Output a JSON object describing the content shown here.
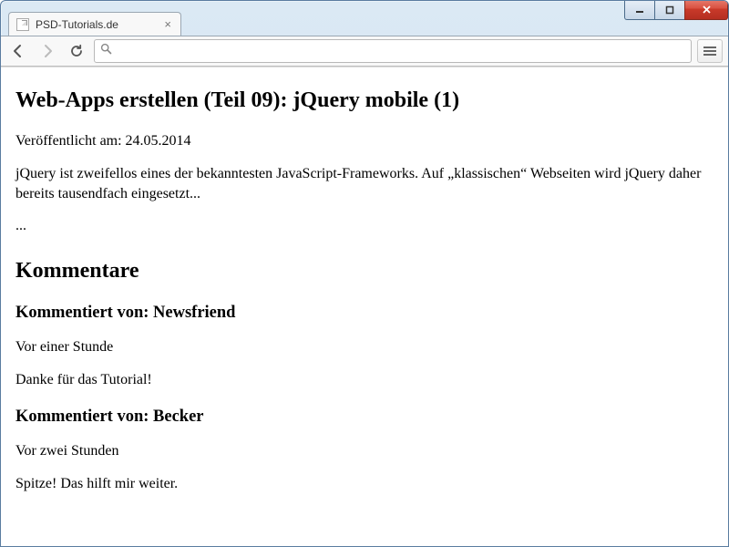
{
  "browser": {
    "tab_title": "PSD-Tutorials.de",
    "url_value": ""
  },
  "article": {
    "title": "Web-Apps erstellen (Teil 09): jQuery mobile (1)",
    "published_label": "Veröffentlicht am: 24.05.2014",
    "intro": "jQuery ist zweifellos eines der bekanntesten JavaScript-Frameworks. Auf „klassischen“ Webseiten wird jQuery daher bereits tausendfach eingesetzt...",
    "ellipsis": "..."
  },
  "comments": {
    "heading": "Kommentare",
    "items": [
      {
        "author_line": "Kommentiert von: Newsfriend",
        "time": "Vor einer Stunde",
        "body": "Danke für das Tutorial!"
      },
      {
        "author_line": "Kommentiert von: Becker",
        "time": "Vor zwei Stunden",
        "body": "Spitze! Das hilft mir weiter."
      }
    ]
  }
}
